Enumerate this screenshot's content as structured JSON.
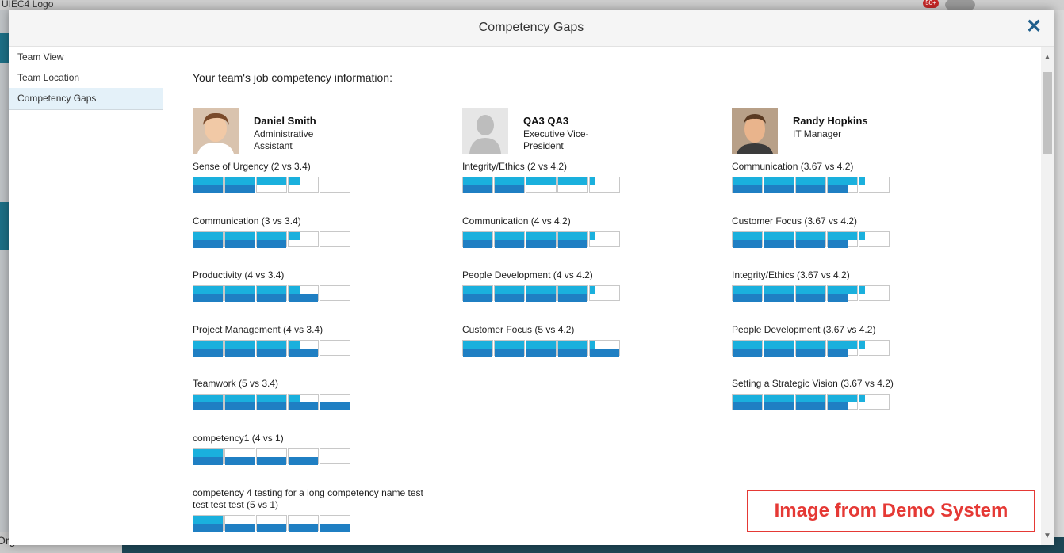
{
  "background": {
    "logo_text": "UIEC4 Logo",
    "badge": "50+",
    "bottom_label": "Org Chart"
  },
  "modal": {
    "title": "Competency Gaps",
    "close_label": "✕"
  },
  "sidebar": {
    "items": [
      {
        "label": "Team View",
        "active": false
      },
      {
        "label": "Team Location",
        "active": false
      },
      {
        "label": "Competency Gaps",
        "active": true
      }
    ]
  },
  "intro": "Your team's job competency information:",
  "people": [
    {
      "name": "Daniel Smith",
      "title": "Administrative Assistant",
      "avatar": "photo-person-icon",
      "competencies": [
        {
          "label": "Sense of Urgency (2 vs 3.4)",
          "actual": 2,
          "required": 3.4
        },
        {
          "label": "Communication (3 vs 3.4)",
          "actual": 3,
          "required": 3.4
        },
        {
          "label": "Productivity (4 vs 3.4)",
          "actual": 4,
          "required": 3.4
        },
        {
          "label": "Project Management (4 vs 3.4)",
          "actual": 4,
          "required": 3.4
        },
        {
          "label": "Teamwork (5 vs 3.4)",
          "actual": 5,
          "required": 3.4
        },
        {
          "label": "competency1 (4 vs 1)",
          "actual": 4,
          "required": 1
        },
        {
          "label": "competency 4 testing for a long competency name test test test test (5 vs 1)",
          "actual": 5,
          "required": 1
        }
      ]
    },
    {
      "name": "QA3 QA3",
      "title": "Executive Vice-President",
      "avatar": "placeholder-person-icon",
      "competencies": [
        {
          "label": "Integrity/Ethics (2 vs 4.2)",
          "actual": 2,
          "required": 4.2
        },
        {
          "label": "Communication (4 vs 4.2)",
          "actual": 4,
          "required": 4.2
        },
        {
          "label": "People Development (4 vs 4.2)",
          "actual": 4,
          "required": 4.2
        },
        {
          "label": "Customer Focus (5 vs 4.2)",
          "actual": 5,
          "required": 4.2
        }
      ]
    },
    {
      "name": "Randy Hopkins",
      "title": "IT Manager",
      "avatar": "photo-person-icon",
      "competencies": [
        {
          "label": "Communication (3.67 vs 4.2)",
          "actual": 3.67,
          "required": 4.2
        },
        {
          "label": "Customer Focus (3.67 vs 4.2)",
          "actual": 3.67,
          "required": 4.2
        },
        {
          "label": "Integrity/Ethics (3.67 vs 4.2)",
          "actual": 3.67,
          "required": 4.2
        },
        {
          "label": "People Development (3.67 vs 4.2)",
          "actual": 3.67,
          "required": 4.2
        },
        {
          "label": "Setting a Strategic Vision (3.67 vs 4.2)",
          "actual": 3.67,
          "required": 4.2
        }
      ]
    }
  ],
  "colors": {
    "required": "#1ab0dd",
    "actual": "#1f7fc3",
    "watermark": "#e53935"
  },
  "watermark": "Image from Demo System"
}
